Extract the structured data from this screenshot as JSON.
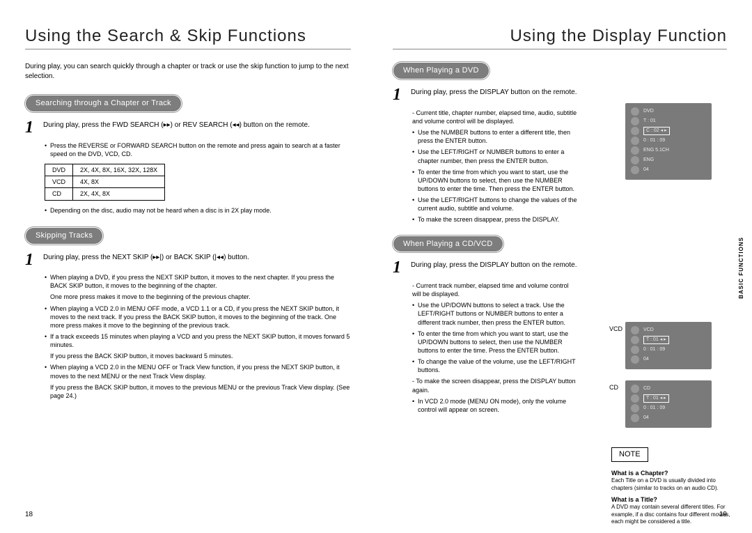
{
  "left": {
    "title": "Using the Search & Skip Functions",
    "intro": "During play, you can search quickly through a chapter or track or use the skip function to jump to the next selection.",
    "section1_title": "Searching through a Chapter or Track",
    "step1": "During play, press the FWD SEARCH (▸▸) or REV SEARCH (◂◂) button on the remote.",
    "b1": "Press the REVERSE or FORWARD SEARCH button on the remote and press again to search at a faster speed on the DVD, VCD, CD.",
    "tbl": {
      "r1a": "DVD",
      "r1b": "2X, 4X, 8X, 16X, 32X, 128X",
      "r2a": "VCD",
      "r2b": "4X, 8X",
      "r3a": "CD",
      "r3b": "2X, 4X, 8X"
    },
    "b2": "Depending on the disc, audio may not be heard when a disc is in 2X play mode.",
    "section2_title": "Skipping Tracks",
    "step2": "During play, press the NEXT SKIP (▸▸|) or BACK SKIP (|◂◂) button.",
    "sb1": "When playing a DVD, if you press the NEXT SKIP button, it moves to the next chapter. If you press the BACK SKIP button, it moves to the beginning of the chapter.",
    "sp1": "One more press makes it move to the beginning of the previous chapter.",
    "sb2": "When playing a VCD 2.0 in MENU OFF mode, a VCD 1.1 or a CD, if you press the NEXT SKIP button, it moves to the next track. If you press the BACK SKIP button, it moves to the beginning of the track. One more press makes it move to the beginning of the previous track.",
    "sb3": "If a track exceeds 15 minutes when playing a VCD and you press the NEXT SKIP button, it moves forward 5 minutes.",
    "sp3": "If you press the BACK SKIP button, it moves backward 5 minutes.",
    "sb4": "When playing a VCD 2.0 in the MENU OFF or Track View function, if you press the NEXT SKIP button, it moves to the next MENU or the next Track View display.",
    "sp4": "If you press the BACK SKIP button, it moves to the previous MENU or the previous Track View display. (See page 24.)",
    "page": "18"
  },
  "right": {
    "title": "Using the Display Function",
    "section1_title": "When Playing a DVD",
    "step1": "During play, press the DISPLAY button on the remote.",
    "d1": "Current title, chapter number, elapsed time, audio, subtitle and volume control will be displayed.",
    "b1": "Use the NUMBER buttons to enter a different title, then press the ENTER button.",
    "b2": "Use the LEFT/RIGHT or NUMBER buttons to enter a chapter number, then press the ENTER button.",
    "b3": "To enter the time from which you want to start, use the UP/DOWN buttons to select, then use the NUMBER buttons to enter the time. Then press the ENTER button.",
    "b4": "Use the LEFT/RIGHT buttons to change the values of the current audio, subtitle and volume.",
    "b5": "To make the screen disappear, press the DISPLAY.",
    "section2_title": "When Playing a CD/VCD",
    "step2": "During play, press the DISPLAY button on the remote.",
    "d2": "Current track number, elapsed time and volume control will be displayed.",
    "c1": "Use the UP/DOWN buttons to select a track. Use the LEFT/RIGHT buttons or NUMBER buttons to enter a different track number, then press the ENTER button.",
    "c2": "To enter the time from which you want to start, use the UP/DOWN buttons to select, then use the NUMBER buttons to enter the time. Press the ENTER button.",
    "c3": "To change the value of the volume, use the LEFT/RIGHT buttons.",
    "d3": "To make the screen disappear, press the DISPLAY button again.",
    "c4": "In VCD 2.0 mode (MENU ON mode), only the volume control will appear on screen.",
    "panel_dvd": {
      "l1": "DVD",
      "l2": "T : 01",
      "l3": "C : 02 ◂ ▸",
      "l4": "0 : 01 : 09",
      "l5": "ENG 5.1CH",
      "l6": "ENG",
      "l7": "04"
    },
    "vcd_lbl": "VCD",
    "cd_lbl": "CD",
    "panel_vcd": {
      "l1": "VCD",
      "l2": "T : 01 ◂ ▸",
      "l3": "0 : 01 : 09",
      "l4": "04"
    },
    "panel_cd": {
      "l1": "CD",
      "l2": "T : 01 ◂ ▸",
      "l3": "0 : 01 : 09",
      "l4": "04"
    },
    "note_label": "NOTE",
    "note_h1": "What is a Chapter?",
    "note_t1": "Each Title on a DVD is usually divided into chapters (similar to tracks on an audio CD).",
    "note_h2": "What is a Title?",
    "note_t2": "A DVD may contain several different titles. For example, if a disc contains four different movies, each might be considered a title.",
    "page": "19"
  },
  "side_tab": "BASIC FUNCTIONS"
}
